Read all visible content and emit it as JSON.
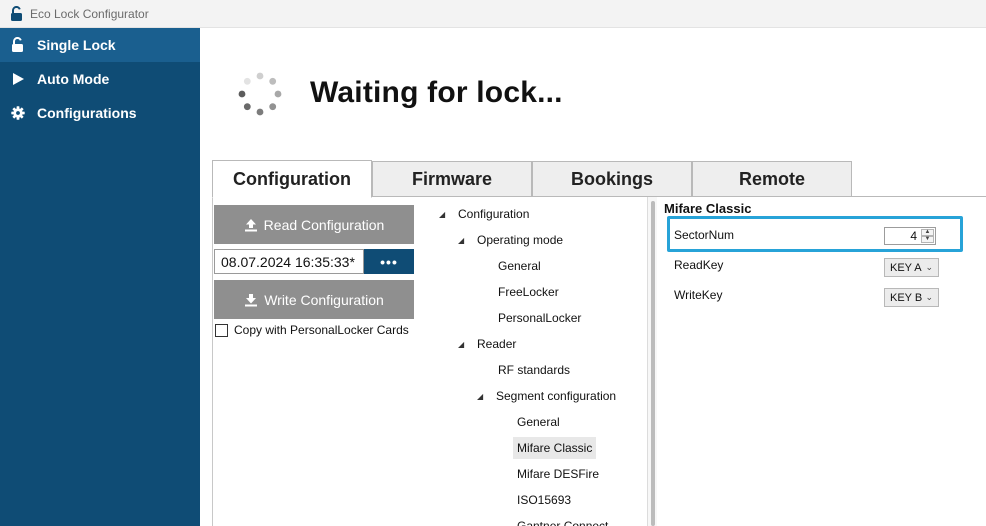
{
  "window": {
    "title": "Eco Lock Configurator",
    "icon": "unlock-icon"
  },
  "sidebar": {
    "items": [
      {
        "label": "Single Lock",
        "icon": "unlock-icon",
        "active": true
      },
      {
        "label": "Auto Mode",
        "icon": "play-icon",
        "active": false
      },
      {
        "label": "Configurations",
        "icon": "gear-icon",
        "active": false
      }
    ]
  },
  "status": {
    "message": "Waiting for lock..."
  },
  "tabs": [
    {
      "label": "Configuration",
      "active": true
    },
    {
      "label": "Firmware",
      "active": false
    },
    {
      "label": "Bookings",
      "active": false
    },
    {
      "label": "Remote",
      "active": false
    }
  ],
  "config_panel": {
    "read_button": "Read Configuration",
    "write_button": "Write Configuration",
    "timestamp": "08.07.2024 16:35:33*",
    "browse_button": "•••",
    "copy_checkbox": {
      "label": "Copy with PersonalLocker Cards",
      "checked": false
    }
  },
  "tree": {
    "root": "Configuration",
    "operating_mode": "Operating mode",
    "om_general": "General",
    "om_freelocker": "FreeLocker",
    "om_personallocker": "PersonalLocker",
    "reader": "Reader",
    "rf_standards": "RF standards",
    "segment_configuration": "Segment configuration",
    "seg_general": "General",
    "seg_mifare_classic": "Mifare Classic",
    "seg_mifare_desfire": "Mifare DESFire",
    "seg_iso15693": "ISO15693",
    "seg_gantner_connect": "Gantner Connect",
    "selected": "Mifare Classic"
  },
  "properties": {
    "title": "Mifare Classic",
    "sector_num": {
      "label": "SectorNum",
      "value": "4"
    },
    "read_key": {
      "label": "ReadKey",
      "value": "KEY A"
    },
    "write_key": {
      "label": "WriteKey",
      "value": "KEY B"
    }
  },
  "colors": {
    "sidebar": "#0f4c75",
    "sidebar_active": "#1a5f8f",
    "button_gray": "#8f8f8f",
    "highlight": "#27a3d8"
  }
}
